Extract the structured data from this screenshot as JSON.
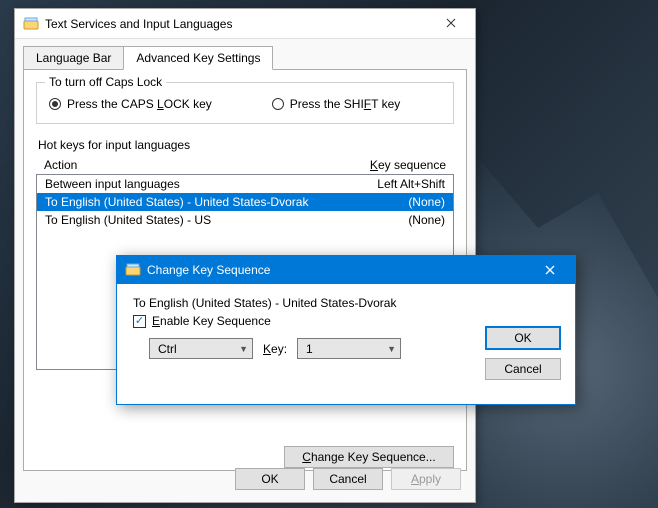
{
  "main": {
    "title": "Text Services and Input Languages",
    "tabs": [
      "Language Bar",
      "Advanced Key Settings"
    ],
    "active_tab": 1,
    "capslock": {
      "group_label": "To turn off Caps Lock",
      "opt_caps_pre": "Press the CAPS ",
      "opt_caps_u": "L",
      "opt_caps_post": "OCK key",
      "opt_shift_pre": "Press the SHI",
      "opt_shift_u": "F",
      "opt_shift_post": "T key",
      "selected": "caps"
    },
    "hotkeys": {
      "section_label": "Hot keys for input languages",
      "col_action": "Action",
      "col_keyseq_u": "K",
      "col_keyseq_rest": "ey sequence",
      "rows": [
        {
          "action": "Between input languages",
          "keyseq": "Left Alt+Shift",
          "selected": false
        },
        {
          "action": "To English (United States) - United States-Dvorak",
          "keyseq": "(None)",
          "selected": true
        },
        {
          "action": "To English (United States) - US",
          "keyseq": "(None)",
          "selected": false
        }
      ],
      "change_btn_u": "C",
      "change_btn_rest": "hange Key Sequence..."
    },
    "buttons": {
      "ok": "OK",
      "cancel": "Cancel",
      "apply_u": "A",
      "apply_rest": "pply"
    }
  },
  "sub": {
    "title": "Change Key Sequence",
    "target": "To English (United States) - United States-Dvorak",
    "enable_u": "E",
    "enable_rest": "nable Key Sequence",
    "enable_checked": true,
    "modifier_value": "Ctrl",
    "key_label_u": "K",
    "key_label_rest": "ey:",
    "key_value": "1",
    "ok": "OK",
    "cancel": "Cancel"
  }
}
